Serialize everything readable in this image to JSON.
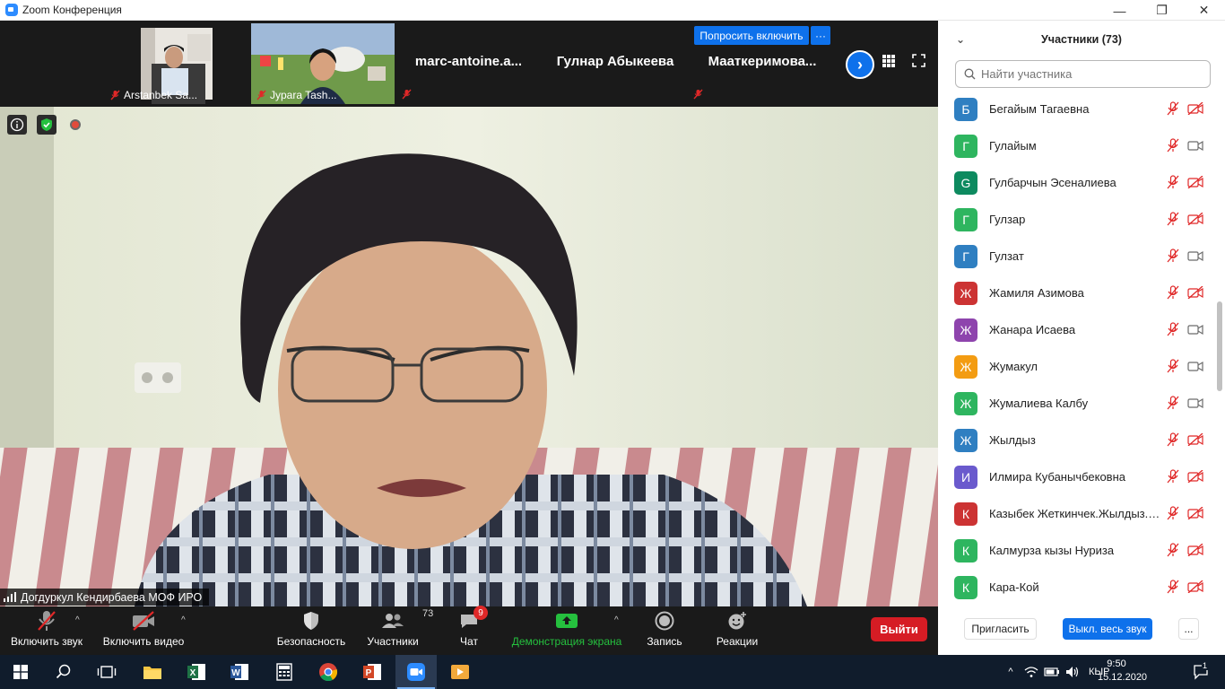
{
  "window": {
    "title": "Zoom Конференция",
    "minimize": "—",
    "maximize": "❐",
    "close": "✕"
  },
  "strip": {
    "thumbs": [
      {
        "name": "Arstanbek Sa..."
      },
      {
        "name": "Jypara Tash..."
      }
    ],
    "names": [
      "marc-antoine.a...",
      "Гулнар Абыкеева",
      "Мааткеримова..."
    ],
    "ask_button": "Попросить включить",
    "ask_more": "···",
    "next": "›"
  },
  "speaker": {
    "name": "Догдуркул Кендирбаева МОФ ИРО"
  },
  "toolbar": {
    "unmute": "Включить звук",
    "start_video": "Включить видео",
    "security": "Безопасность",
    "participants": "Участники",
    "participants_count": "73",
    "chat": "Чат",
    "chat_badge": "9",
    "share": "Демонстрация экрана",
    "record": "Запись",
    "reactions": "Реакции",
    "leave": "Выйти"
  },
  "panel": {
    "title": "Участники (73)",
    "search_placeholder": "Найти участника",
    "participants": [
      {
        "initial": "Б",
        "name": "Бегайым Тагаевна",
        "color": "#2f7fc1",
        "cam": "off"
      },
      {
        "initial": "Г",
        "name": "Гулайым",
        "color": "#2eb55f",
        "cam": "on"
      },
      {
        "initial": "G",
        "name": "Гулбарчын Эсеналиева",
        "color": "#0d8a5f",
        "cam": "off"
      },
      {
        "initial": "Г",
        "name": "Гулзар",
        "color": "#2eb55f",
        "cam": "off"
      },
      {
        "initial": "Г",
        "name": "Гулзат",
        "color": "#2f7fc1",
        "cam": "on"
      },
      {
        "initial": "Ж",
        "name": "Жамиля Азимова",
        "color": "#cc3333",
        "cam": "off"
      },
      {
        "initial": "Ж",
        "name": "Жанара Исаева",
        "color": "#8e44ad",
        "cam": "on"
      },
      {
        "initial": "Ж",
        "name": "Жумакул",
        "color": "#f39c12",
        "cam": "on"
      },
      {
        "initial": "Ж",
        "name": "Жумалиева Калбу",
        "color": "#2eb55f",
        "cam": "on"
      },
      {
        "initial": "Ж",
        "name": "Жылдыз",
        "color": "#2f7fc1",
        "cam": "off"
      },
      {
        "initial": "И",
        "name": "Илмира Кубанычбековна",
        "color": "#6a5acd",
        "cam": "off"
      },
      {
        "initial": "К",
        "name": "Казыбек Жеткинчек.Жылдыз.Н...",
        "color": "#cc3333",
        "cam": "off"
      },
      {
        "initial": "К",
        "name": "Калмурза кызы Нуриза",
        "color": "#2eb55f",
        "cam": "off"
      },
      {
        "initial": "К",
        "name": "Кара-Кой",
        "color": "#2eb55f",
        "cam": "off"
      }
    ],
    "invite": "Пригласить",
    "mute_all": "Выкл. весь звук",
    "more": "..."
  },
  "taskbar": {
    "lang": "КЫР",
    "time": "9:50",
    "date": "15.12.2020",
    "notifications": "1"
  },
  "colors": {
    "accent": "#0e71eb",
    "leave": "#d61c24",
    "muted": "#e02828",
    "share_green": "#25c03e"
  }
}
